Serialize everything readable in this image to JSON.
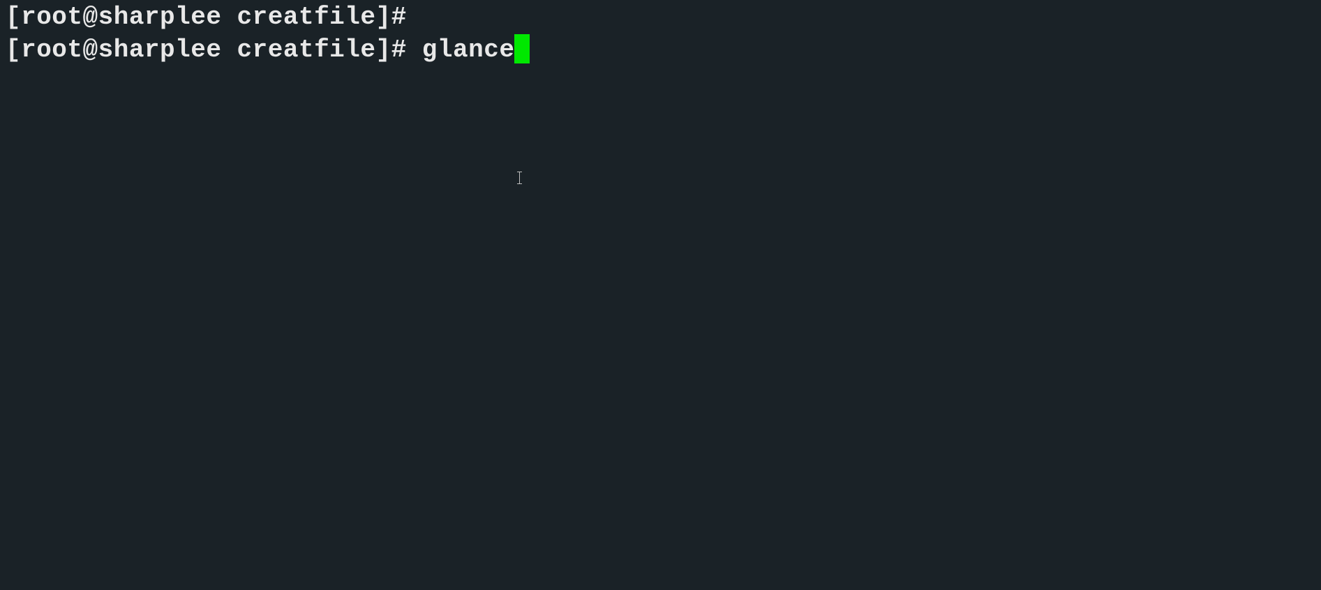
{
  "terminal": {
    "lines": [
      {
        "prompt": "[root@sharplee creatfile]# ",
        "command": ""
      },
      {
        "prompt": "[root@sharplee creatfile]# ",
        "command": "glance"
      }
    ],
    "cursor_color": "#00e800",
    "background_color": "#1a2227",
    "text_color": "#e8e8e8"
  }
}
